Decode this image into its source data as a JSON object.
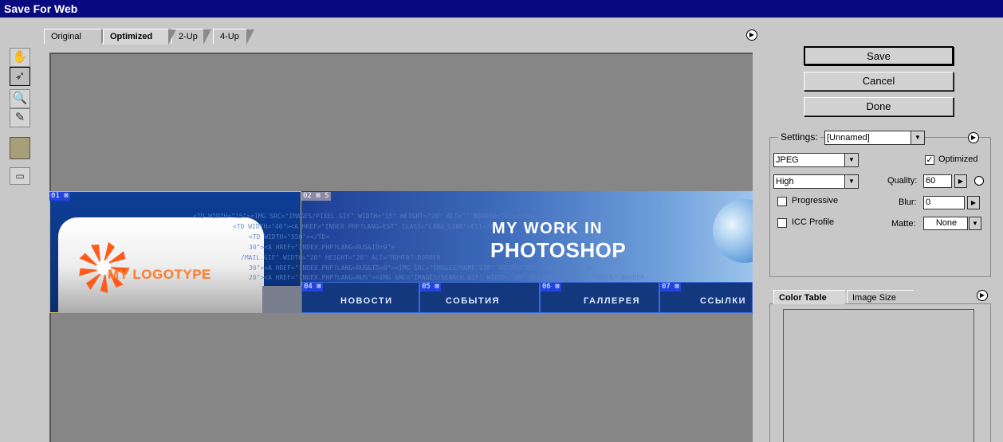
{
  "window": {
    "title": "Save For Web"
  },
  "tabs": [
    "Original",
    "Optimized",
    "2-Up",
    "4-Up"
  ],
  "tools": [
    "hand-icon",
    "slice-select-icon",
    "zoom-icon",
    "eyedropper-icon",
    "color-swatch",
    "preview-icon"
  ],
  "colors": {
    "titlebar": "#0a0a80",
    "swatch": "#a79f77",
    "slice_badge": "#2244dd"
  },
  "image": {
    "logo_text": "MY LOGOTYPE",
    "headline1": "MY WORK IN",
    "headline2": "PHOTOSHOP",
    "code_lines": [
      "<TD WIDTH=\"15\"><IMG SRC=\"IMAGES/PIXEL.GIF\" WIDTH=\"15\" HEIGHT=\"20\" ALT=\"\" BORDER=\"0\"></TD>",
      "<TD WIDTH=\"40\"><A HREF=\"INDEX.PHP?LANG=EST\" CLASS=\"LANG_LINK\">EST</A>",
      "<TD WIDTH=\"550\"></TD>",
      "30\"><A HREF=\"INDEX.PHP?LANG=RUS&ID=9\">",
      "/MAIL.GIF\" WIDTH=\"20\" HEIGHT=\"20\" ALT=\"ПОЧТА\" BORDER",
      "30\"><A HREF=\"INDEX.PHP?LANG=RUS&ID=8\"><IMG SRC=\"IMAGES/HOME.GIF\" WIDTH=\"20\" HEIGHT=\"20\" ALT",
      "20\"><A HREF=\"INDEX.PHP?LANG=RUS\"><IMG SRC=\"IMAGES/SEARCH.GIF\" WIDTH=\"20\" HEIGHT=\"20\" ALT=\"ПОИСК\" BORDER"
    ],
    "slices": [
      "01",
      "02",
      "04",
      "05",
      "06",
      "07"
    ],
    "nav_items": [
      "НОВОСТИ",
      "СОБЫТИЯ",
      "ГАЛЛЕРЕЯ",
      "ССЫЛКИ"
    ]
  },
  "buttons": {
    "save": "Save",
    "cancel": "Cancel",
    "done": "Done"
  },
  "settings": {
    "label": "Settings:",
    "preset": "[Unnamed]",
    "format": "JPEG",
    "quality_preset": "High",
    "optimized_label": "Optimized",
    "optimized_checked": true,
    "quality_label": "Quality:",
    "quality": "60",
    "progressive_label": "Progressive",
    "blur_label": "Blur:",
    "blur": "0",
    "icc_label": "ICC Profile",
    "matte_label": "Matte:",
    "matte": "None"
  },
  "panel_tabs": [
    "Color Table",
    "Image Size"
  ]
}
